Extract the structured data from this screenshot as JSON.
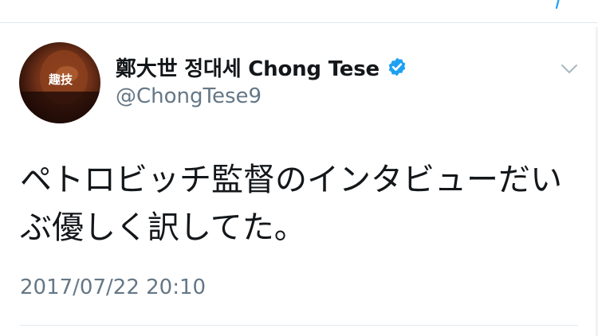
{
  "tweet": {
    "author": {
      "display_name": "鄭大世 정대세 Chong Tese",
      "handle": "@ChongTese9",
      "verified": true,
      "verified_icon": "verified-badge-icon",
      "avatar_overlay_text": "趣技"
    },
    "text": "ペトロビッチ監督のインタビューだいぶ優しく訳してた。",
    "timestamp": "2017/07/22 20:10",
    "menu_icon": "chevron-down-icon"
  },
  "colors": {
    "text_primary": "#14171a",
    "text_secondary": "#657786",
    "verified_blue": "#1da1f2",
    "divider": "#e1e8ed"
  }
}
